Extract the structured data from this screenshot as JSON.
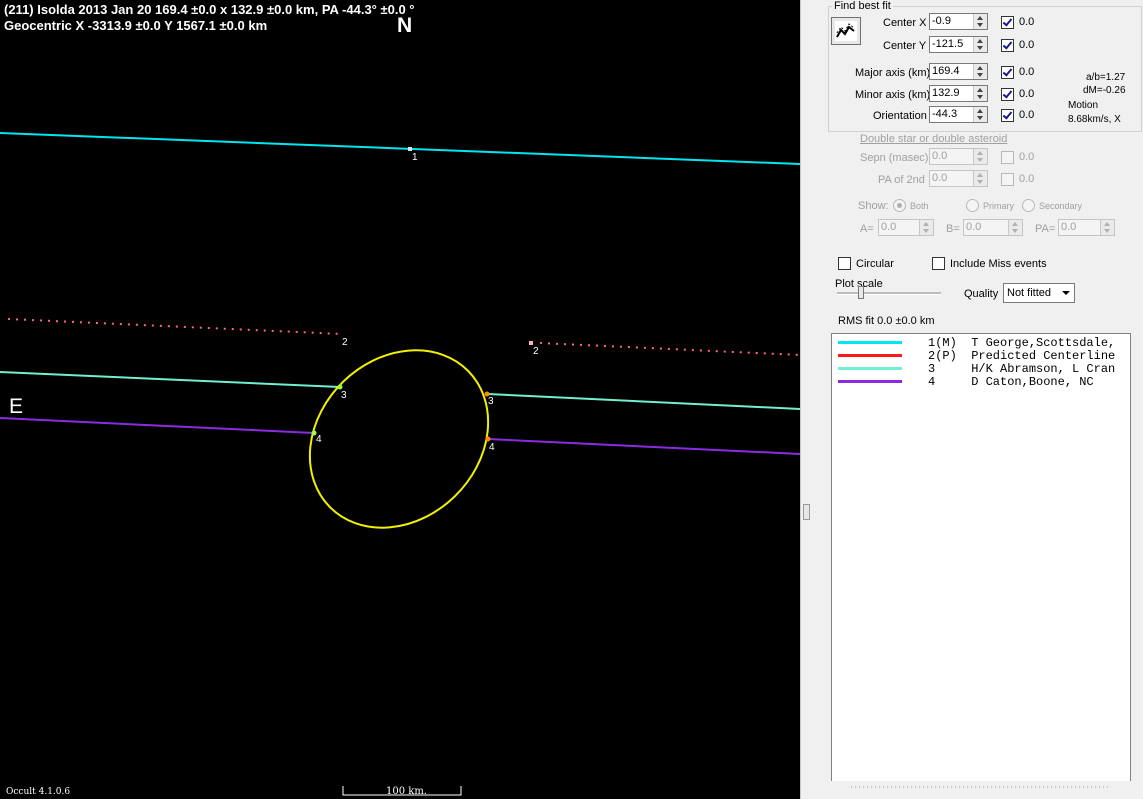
{
  "plot": {
    "title_line1": "(211) Isolda  2013 Jan 20   169.4 ±0.0 x 132.9 ±0.0 km, PA -44.3° ±0.0 °",
    "title_line2": "Geocentric  X  -3313.9 ±0.0  Y 1567.1 ±0.0 km",
    "north_label": "N",
    "east_label": "E",
    "version": "Occult 4.1.0.6",
    "scale_label": "100 km.",
    "chord_labels": [
      "1",
      "2",
      "2",
      "3",
      "3",
      "4",
      "4"
    ],
    "colors": {
      "background": "#000000",
      "ellipse": "#f0f000",
      "chord1": "#00e6f0",
      "chord2": "#ff6680",
      "chord3": "#70f0d0",
      "chord4": "#8a2be2"
    }
  },
  "panel": {
    "section_title": "Find best fit",
    "fit_button_icon": "fit-chart-icon",
    "center_x": {
      "label": "Center X",
      "value": "-0.9",
      "weight": "0.0",
      "checked": true
    },
    "center_y": {
      "label": "Center Y",
      "value": "-121.5",
      "weight": "0.0",
      "checked": true
    },
    "major_axis": {
      "label": "Major axis (km)",
      "value": "169.4",
      "weight": "0.0",
      "checked": true
    },
    "minor_axis": {
      "label": "Minor axis (km)",
      "value": "132.9",
      "weight": "0.0",
      "checked": true
    },
    "orientation": {
      "label": "Orientation",
      "value": "-44.3",
      "weight": "0.0",
      "checked": true
    },
    "ab_ratio": "a/b=1.27",
    "dm": "dM=-0.26",
    "motion_label": "Motion",
    "motion_value": "8.68km/s, X",
    "double_star_title": "Double star  or  double asteroid",
    "sepn": {
      "label": "Sepn (masec)",
      "value": "0.0",
      "weight": "0.0"
    },
    "pa_2nd": {
      "label": "PA of 2nd",
      "value": "0.0",
      "weight": "0.0"
    },
    "show_label": "Show:",
    "show_both": "Both",
    "show_primary": "Primary",
    "show_secondary": "Secondary",
    "a_label": "A=",
    "a_value": "0.0",
    "b_label": "B=",
    "b_value": "0.0",
    "pa_label": "PA=",
    "pa_value": "0.0",
    "circular_label": "Circular",
    "include_miss_label": "Include Miss events",
    "plot_scale_label": "Plot scale",
    "quality_label": "Quality",
    "quality_value": "Not fitted",
    "rms_fit": "RMS fit 0.0 ±0.0 km",
    "legend": [
      {
        "color": "#00e6f0",
        "text": "1(M)  T George,Scottsdale,"
      },
      {
        "color": "#ff1a1a",
        "text": "2(P)  Predicted Centerline"
      },
      {
        "color": "#70f0d0",
        "text": "3     H/K Abramson, L Cran"
      },
      {
        "color": "#8a2be2",
        "text": "4     D Caton,Boone, NC"
      }
    ]
  }
}
